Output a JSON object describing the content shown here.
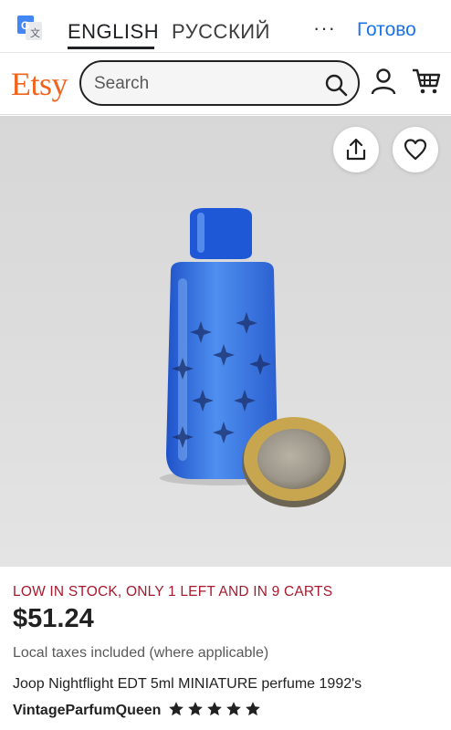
{
  "translate_bar": {
    "lang_source": "ENGLISH",
    "lang_target": "РУССКИЙ",
    "more": "···",
    "done": "Готово"
  },
  "header": {
    "logo": "Etsy",
    "search_placeholder": "Search"
  },
  "product": {
    "stock_notice": "LOW IN STOCK, ONLY 1 LEFT AND IN 9 CARTS",
    "price": "$51.24",
    "tax_note": "Local taxes included (where applicable)",
    "title": "Joop Nightflight EDT 5ml MINIATURE perfume 1992's",
    "shop_name": "VintageParfumQueen",
    "rating": 5,
    "rating_max": 5
  },
  "colors": {
    "etsy_orange": "#f1641e",
    "stock_red": "#a61a2e",
    "translate_blue": "#1a73e8"
  }
}
